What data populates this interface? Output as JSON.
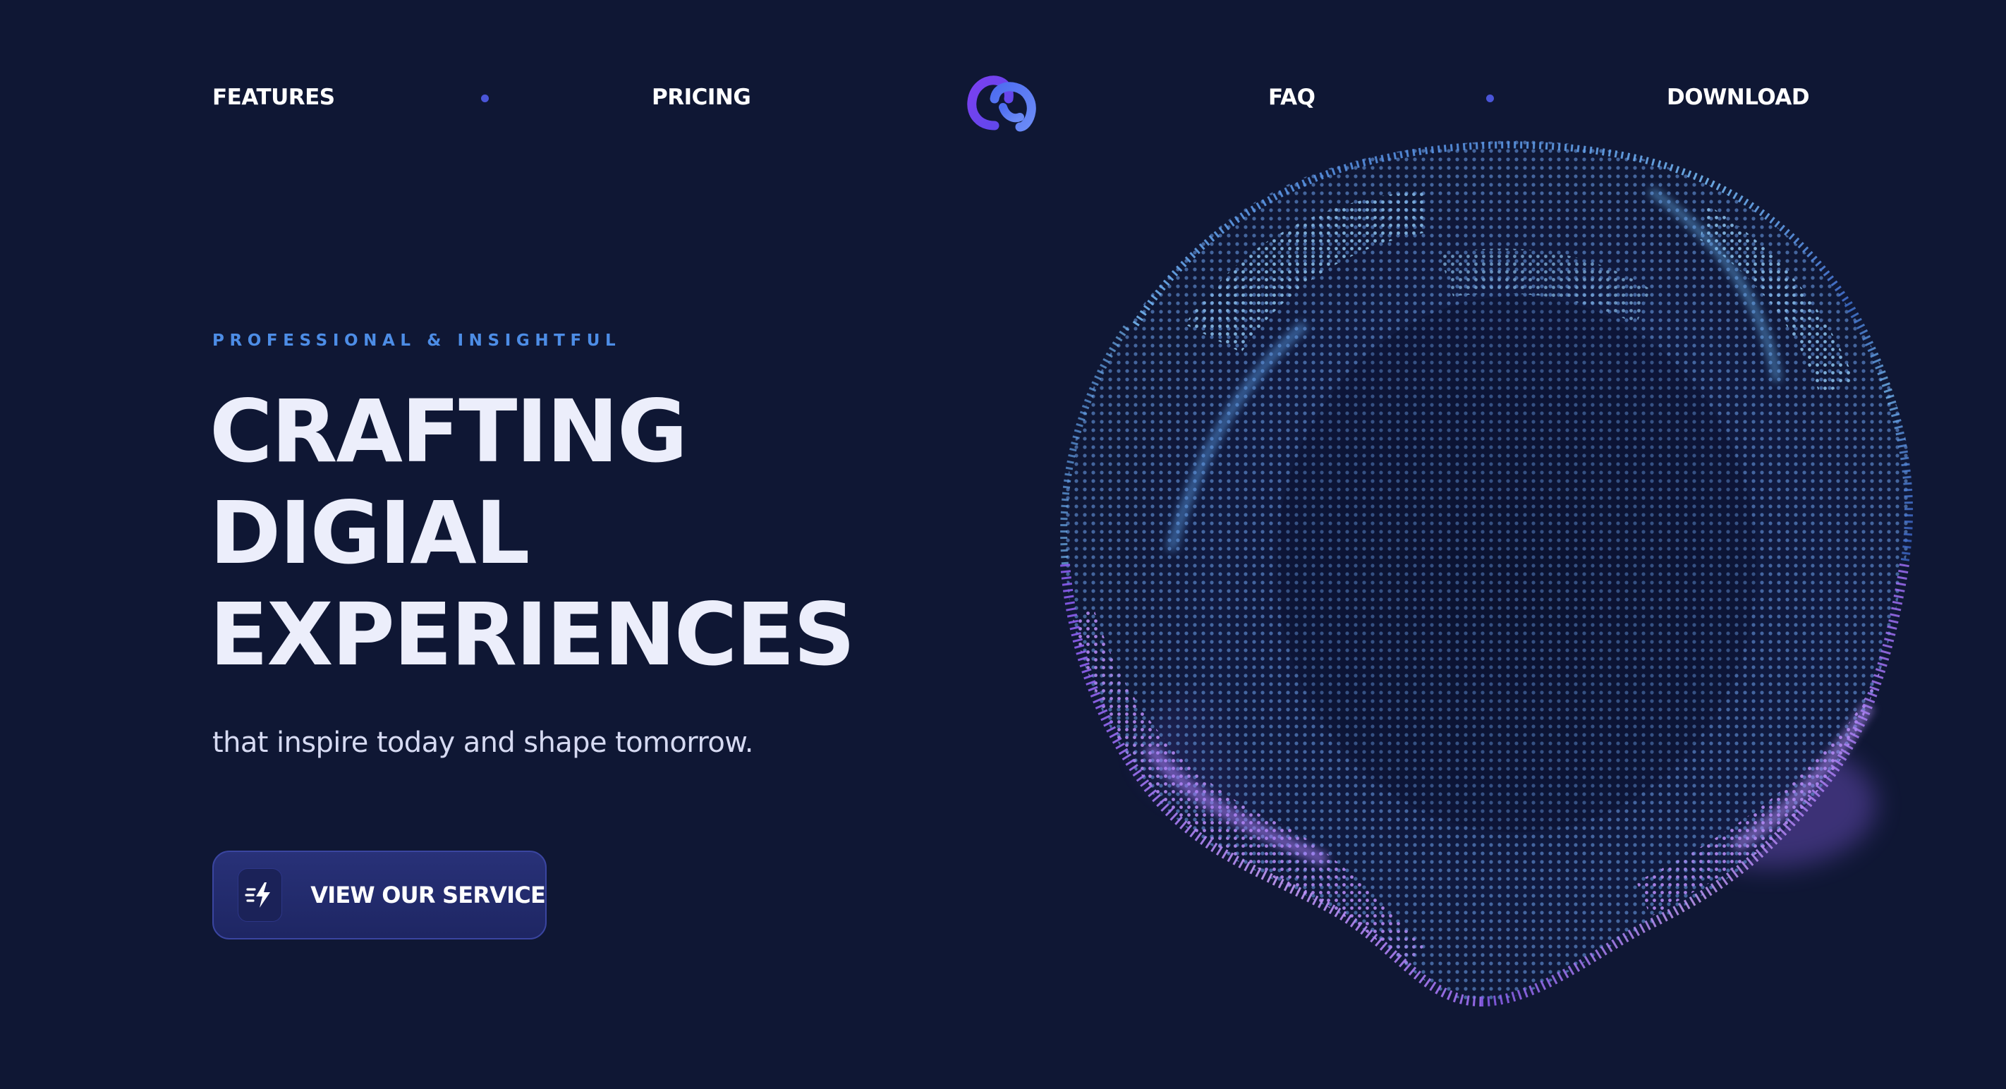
{
  "nav": {
    "left_links": [
      {
        "label": "FEATURES"
      },
      {
        "label": "PRICING"
      }
    ],
    "right_links": [
      {
        "label": "FAQ"
      },
      {
        "label": "DOWNLOAD"
      }
    ],
    "logo_icon": "interlocking-rings-logo",
    "dot_color": "#4a55d8"
  },
  "hero": {
    "eyebrow": "PROFESSIONAL & INSIGHTFUL",
    "headline_lines": [
      "CRAFTING",
      "DIGIAL",
      "EXPERIENCES"
    ],
    "subline": "that inspire today and shape tomorrow.",
    "cta": {
      "label": "VIEW OUR SERVICE",
      "icon": "lightning-bolt-icon"
    },
    "visual": "particle-sphere"
  },
  "colors": {
    "background": "#0f1734",
    "accent_blue": "#4d8de6",
    "accent_violet": "#9b6cf0",
    "button": "#283178",
    "headline": "#eceefb"
  }
}
